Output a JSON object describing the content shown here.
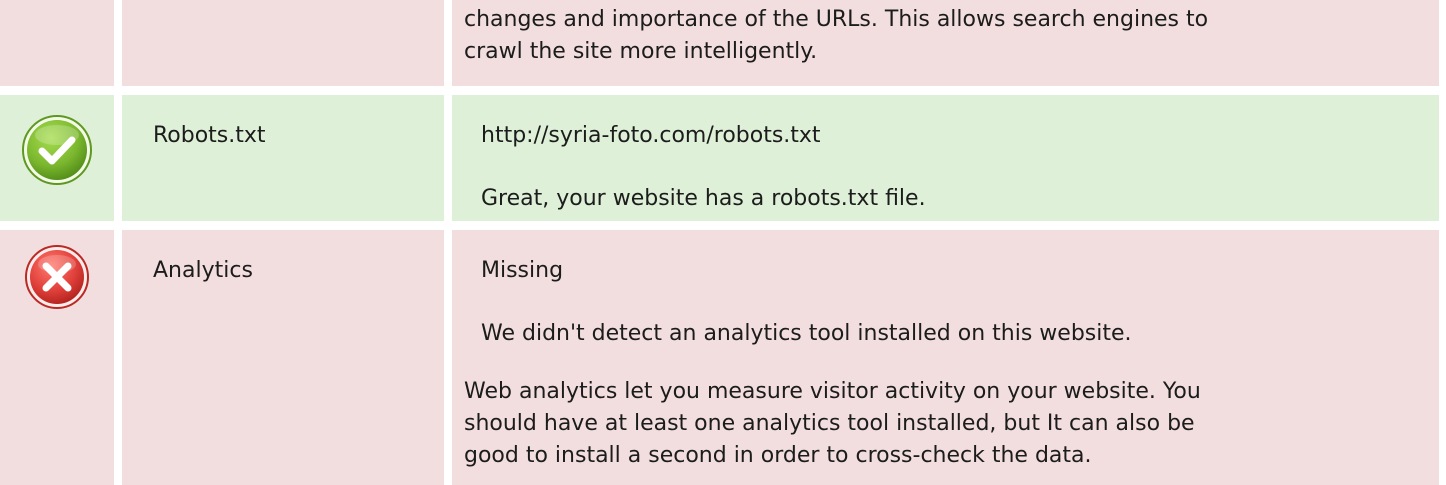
{
  "rows": [
    {
      "status": "fail",
      "check": "",
      "detail": "changes and importance of the URLs. This allows search engines to\ncrawl the site more intelligently."
    },
    {
      "status": "pass",
      "check": "Robots.txt",
      "value": "http://syria-foto.com/robots.txt",
      "message": "Great, your website has a robots.txt file."
    },
    {
      "status": "fail",
      "check": "Analytics",
      "value": "Missing",
      "message": "We didn't detect an analytics tool installed on this website.",
      "detail": "Web analytics let you measure visitor activity on your website. You\nshould have at least one analytics tool installed, but It can also be\ngood to install a second in order to cross-check the data."
    }
  ],
  "colors": {
    "fail_bg": "#f2dede",
    "pass_bg": "#dff0d8",
    "pass_icon": "#7cb82f",
    "fail_icon": "#e0403a"
  },
  "icons": {
    "pass": "check-icon",
    "fail": "cross-icon"
  }
}
